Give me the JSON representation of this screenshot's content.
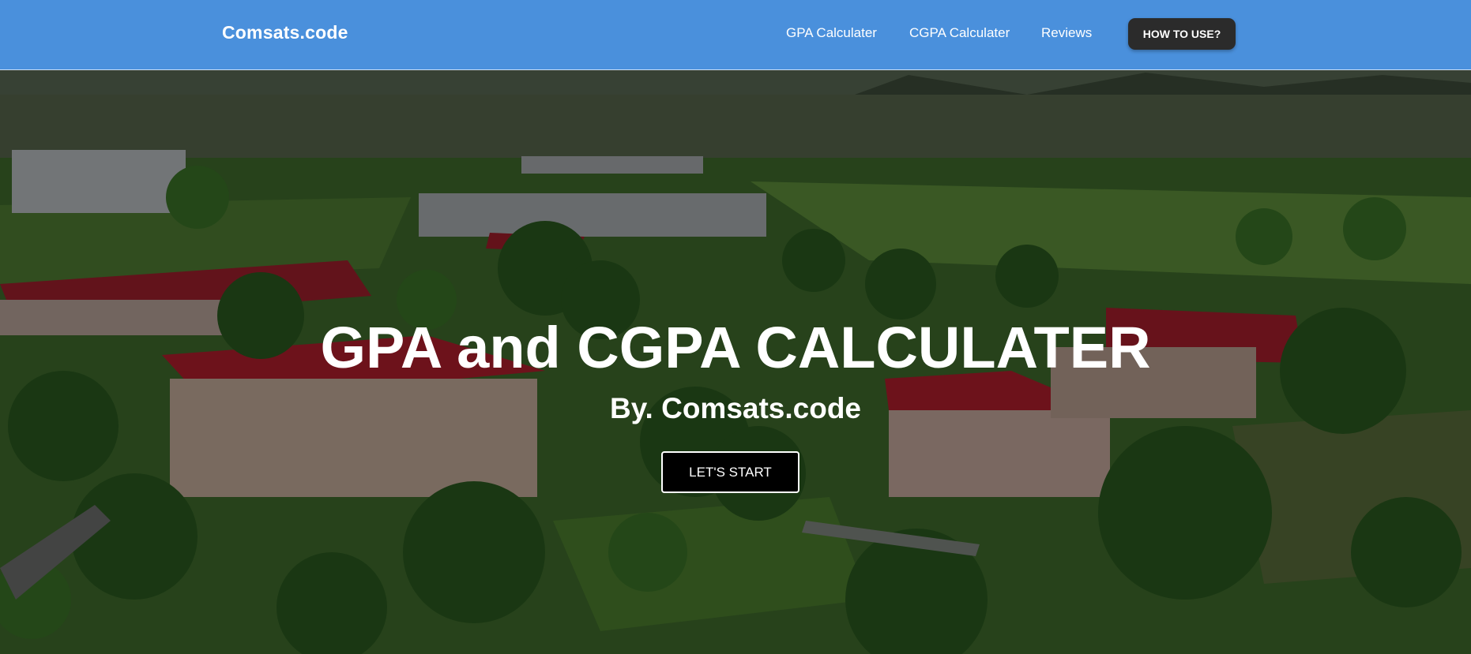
{
  "navbar": {
    "brand": "Comsats.code",
    "links": [
      "GPA Calculater",
      "CGPA Calculater",
      "Reviews"
    ],
    "cta": "HOW TO USE?",
    "background_color": "#4a90dc"
  },
  "hero": {
    "title": "GPA and CGPA CALCULATER",
    "subtitle": "By. Comsats.code",
    "button": "LET'S START",
    "background_image": "campus-aerial-photo"
  }
}
